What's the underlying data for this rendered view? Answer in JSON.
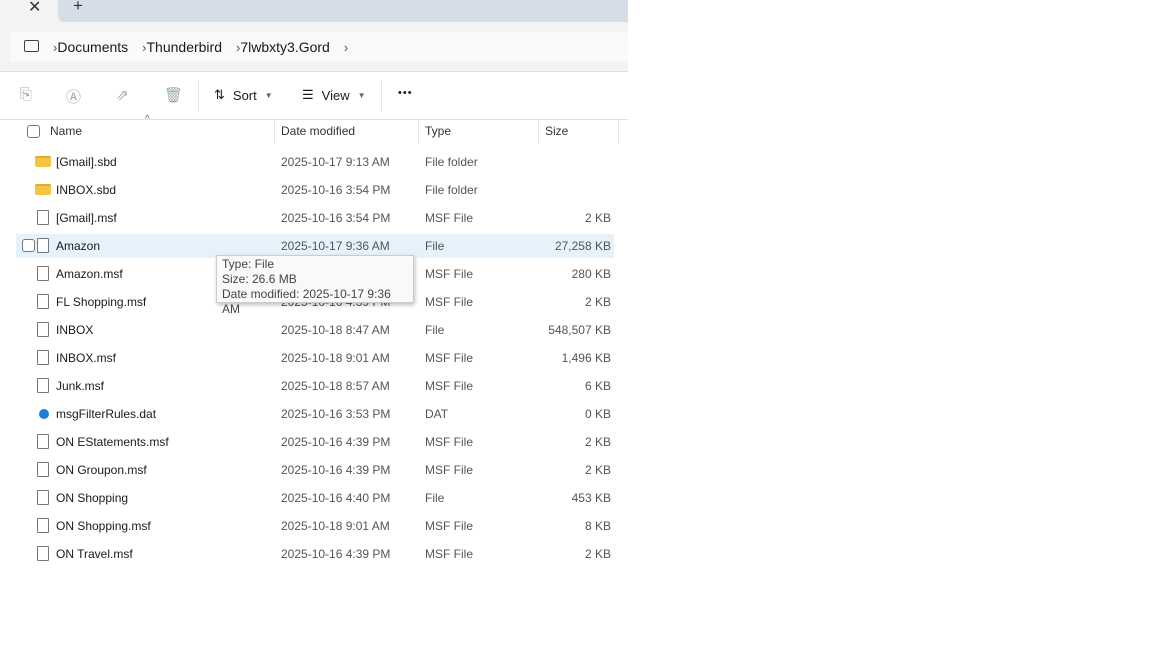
{
  "tabs": {
    "close": "✕",
    "new": "+"
  },
  "breadcrumb": [
    "Documents",
    "Thunderbird",
    "7lwbxty3.Gord"
  ],
  "toolbar": {
    "sort": "Sort",
    "view": "View",
    "more": "•••"
  },
  "columns": {
    "name": "Name",
    "date": "Date modified",
    "type": "Type",
    "size": "Size"
  },
  "files": [
    {
      "name": "[Gmail].sbd",
      "date": "2025-10-17 9:13 AM",
      "type": "File folder",
      "size": "",
      "icon": "folder"
    },
    {
      "name": "INBOX.sbd",
      "date": "2025-10-16 3:54 PM",
      "type": "File folder",
      "size": "",
      "icon": "folder"
    },
    {
      "name": "[Gmail].msf",
      "date": "2025-10-16 3:54 PM",
      "type": "MSF File",
      "size": "2 KB",
      "icon": "file"
    },
    {
      "name": "Amazon",
      "date": "2025-10-17 9:36 AM",
      "type": "File",
      "size": "27,258 KB",
      "icon": "file"
    },
    {
      "name": "Amazon.msf",
      "date": "",
      "type": "MSF File",
      "size": "280 KB",
      "icon": "file"
    },
    {
      "name": "FL Shopping.msf",
      "date": "2025-10-16 4:39 PM",
      "type": "MSF File",
      "size": "2 KB",
      "icon": "file"
    },
    {
      "name": "INBOX",
      "date": "2025-10-18 8:47 AM",
      "type": "File",
      "size": "548,507 KB",
      "icon": "file"
    },
    {
      "name": "INBOX.msf",
      "date": "2025-10-18 9:01 AM",
      "type": "MSF File",
      "size": "1,496 KB",
      "icon": "file"
    },
    {
      "name": "Junk.msf",
      "date": "2025-10-18 8:57 AM",
      "type": "MSF File",
      "size": "6 KB",
      "icon": "file"
    },
    {
      "name": "msgFilterRules.dat",
      "date": "2025-10-16 3:53 PM",
      "type": "DAT",
      "size": "0 KB",
      "icon": "dat"
    },
    {
      "name": "ON EStatements.msf",
      "date": "2025-10-16 4:39 PM",
      "type": "MSF File",
      "size": "2 KB",
      "icon": "file"
    },
    {
      "name": "ON Groupon.msf",
      "date": "2025-10-16 4:39 PM",
      "type": "MSF File",
      "size": "2 KB",
      "icon": "file"
    },
    {
      "name": "ON Shopping",
      "date": "2025-10-16 4:40 PM",
      "type": "File",
      "size": "453 KB",
      "icon": "file"
    },
    {
      "name": "ON Shopping.msf",
      "date": "2025-10-18 9:01 AM",
      "type": "MSF File",
      "size": "8 KB",
      "icon": "file"
    },
    {
      "name": "ON Travel.msf",
      "date": "2025-10-16 4:39 PM",
      "type": "MSF File",
      "size": "2 KB",
      "icon": "file"
    }
  ],
  "tooltip": {
    "line1": "Type: File",
    "line2": "Size: 26.6 MB",
    "line3": "Date modified: 2025-10-17 9:36 AM"
  }
}
